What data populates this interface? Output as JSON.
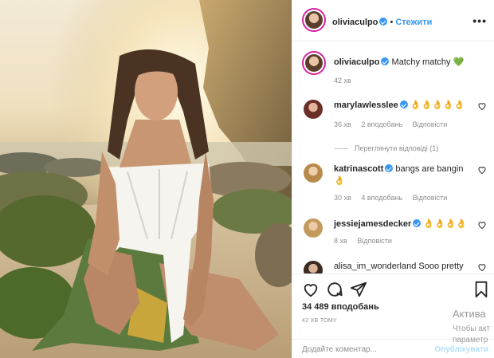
{
  "post": {
    "author": "oliviaculpo",
    "follow_label": "Стежити",
    "dot": "•",
    "more": "•••",
    "caption_text": "Matchy matchy 💚",
    "caption_time": "42 хв"
  },
  "comments": [
    {
      "user": "marylawlesslee",
      "verified": true,
      "text": "👌👌👌👌👌",
      "time": "36 хв",
      "likes": "2 вподобань",
      "reply": "Відповісти"
    },
    {
      "user": "katrinascott",
      "verified": true,
      "text": "bangs are bangin 👌",
      "time": "30 хв",
      "likes": "4 вподобань",
      "reply": "Відповісти"
    },
    {
      "user": "jessiejamesdecker",
      "verified": true,
      "text": "👌👌👌👌",
      "time": "8 хв",
      "likes": "",
      "reply": "Відповісти"
    },
    {
      "user": "alisa_im_wonderland",
      "verified": false,
      "text": "Sooo pretty",
      "time": "",
      "likes": "",
      "reply": ""
    }
  ],
  "view_replies": "Переглянути відповіді (1)",
  "footer": {
    "likes_count": "34 489 вподобань",
    "post_time": "42 ХВ ТОМУ",
    "add_comment_placeholder": "Додайте коментар...",
    "publish_label": "Опублікувати"
  },
  "watermark": {
    "line1": "Актива",
    "line2": "Чтобы акт",
    "line3": "параметр"
  },
  "icons": {
    "more": "more-options-icon",
    "like": "heart-icon",
    "comment": "comment-icon",
    "share": "share-icon",
    "save": "bookmark-icon"
  },
  "colors": {
    "accent": "#3897f0",
    "text": "#262626",
    "muted": "#8e8e8e",
    "ring": "#d6249f",
    "skirt_green": "#5c7a3e"
  }
}
